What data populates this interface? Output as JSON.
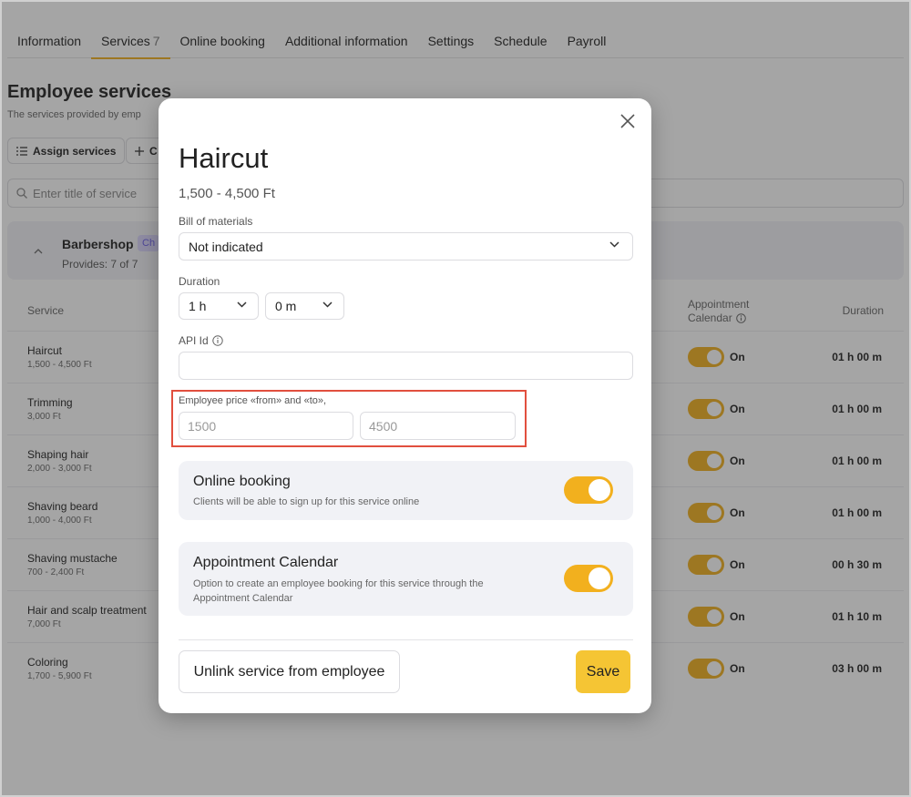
{
  "tabs": [
    {
      "label": "Information"
    },
    {
      "label": "Services",
      "count": "7"
    },
    {
      "label": "Online booking"
    },
    {
      "label": "Additional information"
    },
    {
      "label": "Settings"
    },
    {
      "label": "Schedule"
    },
    {
      "label": "Payroll"
    }
  ],
  "page": {
    "title": "Employee services",
    "subtitle": "The services provided by emp",
    "assign_label": "Assign services",
    "create_label": "C",
    "search_placeholder": "Enter title of service"
  },
  "group": {
    "name": "Barbershop",
    "badge": "Ch",
    "provides": "Provides: 7 of 7"
  },
  "table": {
    "col_service": "Service",
    "col_calendar_line1": "Appointment",
    "col_calendar_line2": "Calendar",
    "col_duration": "Duration",
    "on_label": "On",
    "rows": [
      {
        "name": "Haircut",
        "price": "1,500 - 4,500 Ft",
        "duration": "01 h 00 m"
      },
      {
        "name": "Trimming",
        "price": "3,000 Ft",
        "duration": "01 h 00 m"
      },
      {
        "name": "Shaping hair",
        "price": "2,000 - 3,000 Ft",
        "duration": "01 h 00 m"
      },
      {
        "name": "Shaving beard",
        "price": "1,000 - 4,000 Ft",
        "duration": "01 h 00 m"
      },
      {
        "name": "Shaving mustache",
        "price": "700 - 2,400 Ft",
        "duration": "00 h 30 m"
      },
      {
        "name": "Hair and scalp treatment",
        "price": "7,000 Ft",
        "duration": "01 h 10 m"
      },
      {
        "name": "Coloring",
        "price": "1,700 - 5,900 Ft",
        "duration": "03 h 00 m"
      }
    ]
  },
  "modal": {
    "title": "Haircut",
    "price": "1,500 - 4,500 Ft",
    "bom_label": "Bill of materials",
    "bom_value": "Not indicated",
    "duration_label": "Duration",
    "duration_hours": "1 h",
    "duration_minutes": "0 m",
    "api_label": "API Id",
    "api_value": "",
    "emp_price_label": "Employee price «from» and «to»,",
    "price_from_placeholder": "1500",
    "price_to_placeholder": "4500",
    "online_title": "Online booking",
    "online_desc": "Clients will be able to sign up for this service online",
    "calendar_title": "Appointment Calendar",
    "calendar_desc": "Option to create an employee booking for this service through the Appointment Calendar",
    "unlink_label": "Unlink service from employee",
    "save_label": "Save"
  },
  "colors": {
    "accent": "#f2b01e",
    "save": "#f5c534",
    "highlight": "#e14f3e"
  }
}
